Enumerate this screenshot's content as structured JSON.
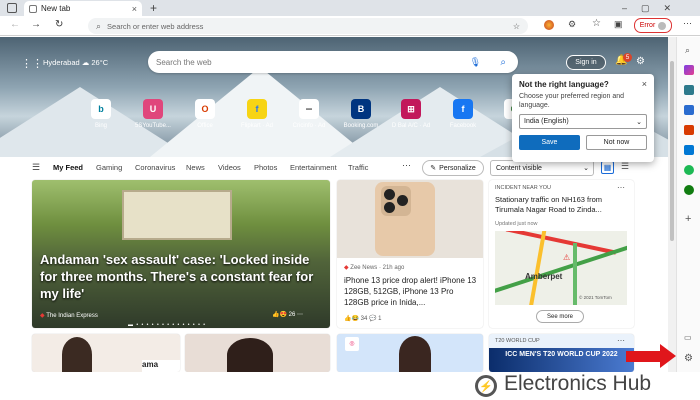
{
  "browser": {
    "tab_title": "New tab",
    "address_placeholder": "Search or enter web address",
    "error_label": "Error"
  },
  "header": {
    "city": "Hyderabad",
    "temp": "26°C",
    "search_placeholder": "Search the web",
    "sign_in": "Sign in",
    "notif_count": "5"
  },
  "quick_links": [
    "Bing",
    "5SYouTube...",
    "Office",
    "Flipkart · Ad",
    "Cricinfo · Ad",
    "Booking.com",
    "D Bal A/C · Ad",
    "Facebook"
  ],
  "language_popup": {
    "title": "Not the right language?",
    "desc": "Choose your preferred region and language.",
    "selected": "India (English)",
    "save": "Save",
    "not_now": "Not now"
  },
  "feed": {
    "items": [
      "My Feed",
      "Gaming",
      "Coronavirus",
      "News",
      "Videos",
      "Photos",
      "Entertainment",
      "Traffic"
    ],
    "personalize": "Personalize",
    "visibility": "Content visible"
  },
  "card1": {
    "headline": "Andaman 'sex assault' case: 'Locked inside for three months. There's a constant fear for my life'",
    "source": "The Indian Express",
    "reactions": "26"
  },
  "card2": {
    "source": "Zee News · 21h ago",
    "headline": "iPhone 13 price drop alert! iPhone 13 128GB, 512GB, iPhone 13 Pro 128GB price in Inida,...",
    "reactions": "34",
    "comments": "1"
  },
  "card3": {
    "label": "INCIDENT NEAR YOU",
    "headline": "Stationary traffic on NH163 from Tirumala Nagar Road to Zinda...",
    "updated": "Updated just now",
    "map_text": "Amberpet",
    "copyright": "© 2021 TomTom",
    "see_more": "See more"
  },
  "card4": {
    "label": "T20 WORLD CUP",
    "headline": "ICC MEN'S T20 WORLD CUP 2022"
  },
  "watermark": "Electronics Hub",
  "colors": {
    "accent": "#0067c0",
    "red_arrow": "#e0161b"
  }
}
